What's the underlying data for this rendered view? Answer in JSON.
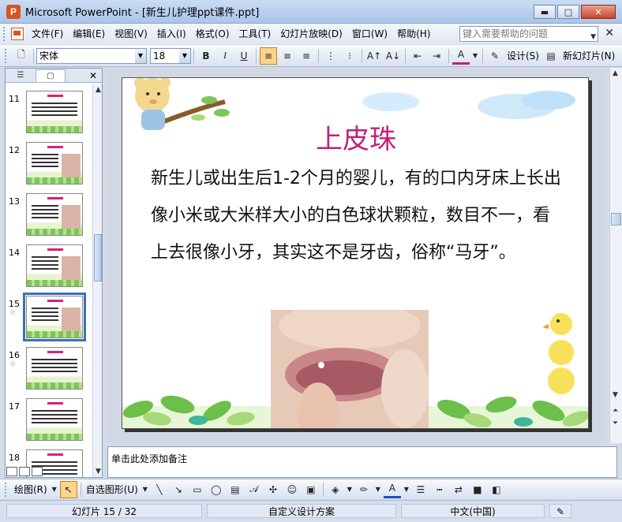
{
  "window": {
    "title": "Microsoft PowerPoint - [新生儿护理ppt课件.ppt]",
    "app_icon_letter": "P",
    "buttons": {
      "minimize": "▬",
      "maximize": "□",
      "close": "✕"
    }
  },
  "menubar": {
    "items": [
      "文件(F)",
      "编辑(E)",
      "视图(V)",
      "插入(I)",
      "格式(O)",
      "工具(T)",
      "幻灯片放映(D)",
      "窗口(W)",
      "帮助(H)"
    ],
    "help_placeholder": "键入需要帮助的问题",
    "close_symbol": "✕"
  },
  "toolbar": {
    "font_name": "宋体",
    "font_size": "18",
    "bold": "B",
    "italic": "I",
    "underline": "U",
    "design_label": "设计(S)",
    "new_slide_label": "新幻灯片(N)"
  },
  "outline_pane": {
    "tab_outline": "☰",
    "tab_slides": "▢",
    "close": "✕",
    "thumbnails": [
      {
        "num": "11",
        "star": "",
        "selected": false,
        "has_photo": false
      },
      {
        "num": "12",
        "star": "",
        "selected": false,
        "has_photo": true
      },
      {
        "num": "13",
        "star": "",
        "selected": false,
        "has_photo": true
      },
      {
        "num": "14",
        "star": "",
        "selected": false,
        "has_photo": true
      },
      {
        "num": "15",
        "star": "☆",
        "selected": true,
        "has_photo": true
      },
      {
        "num": "16",
        "star": "☆",
        "selected": false,
        "has_photo": false
      },
      {
        "num": "17",
        "star": "",
        "selected": false,
        "has_photo": false
      },
      {
        "num": "18",
        "star": "",
        "selected": false,
        "has_photo": false
      }
    ]
  },
  "slide": {
    "title": "上皮珠",
    "body": "新生儿或出生后1-2个月的婴儿，有的口内牙床上长出像小米或大米样大小的白色球状颗粒，数目不一，看上去很像小牙，其实这不是牙齿，俗称“马牙”。"
  },
  "notes": {
    "placeholder": "单击此处添加备注"
  },
  "drawbar": {
    "draw_label": "绘图(R)",
    "autoshapes_label": "自选图形(U)"
  },
  "statusbar": {
    "slide_position": "幻灯片 15 / 32",
    "design": "自定义设计方案",
    "language": "中文(中国)"
  },
  "colors": {
    "title_accent": "#c1207a",
    "selection": "#3b6fb9"
  }
}
